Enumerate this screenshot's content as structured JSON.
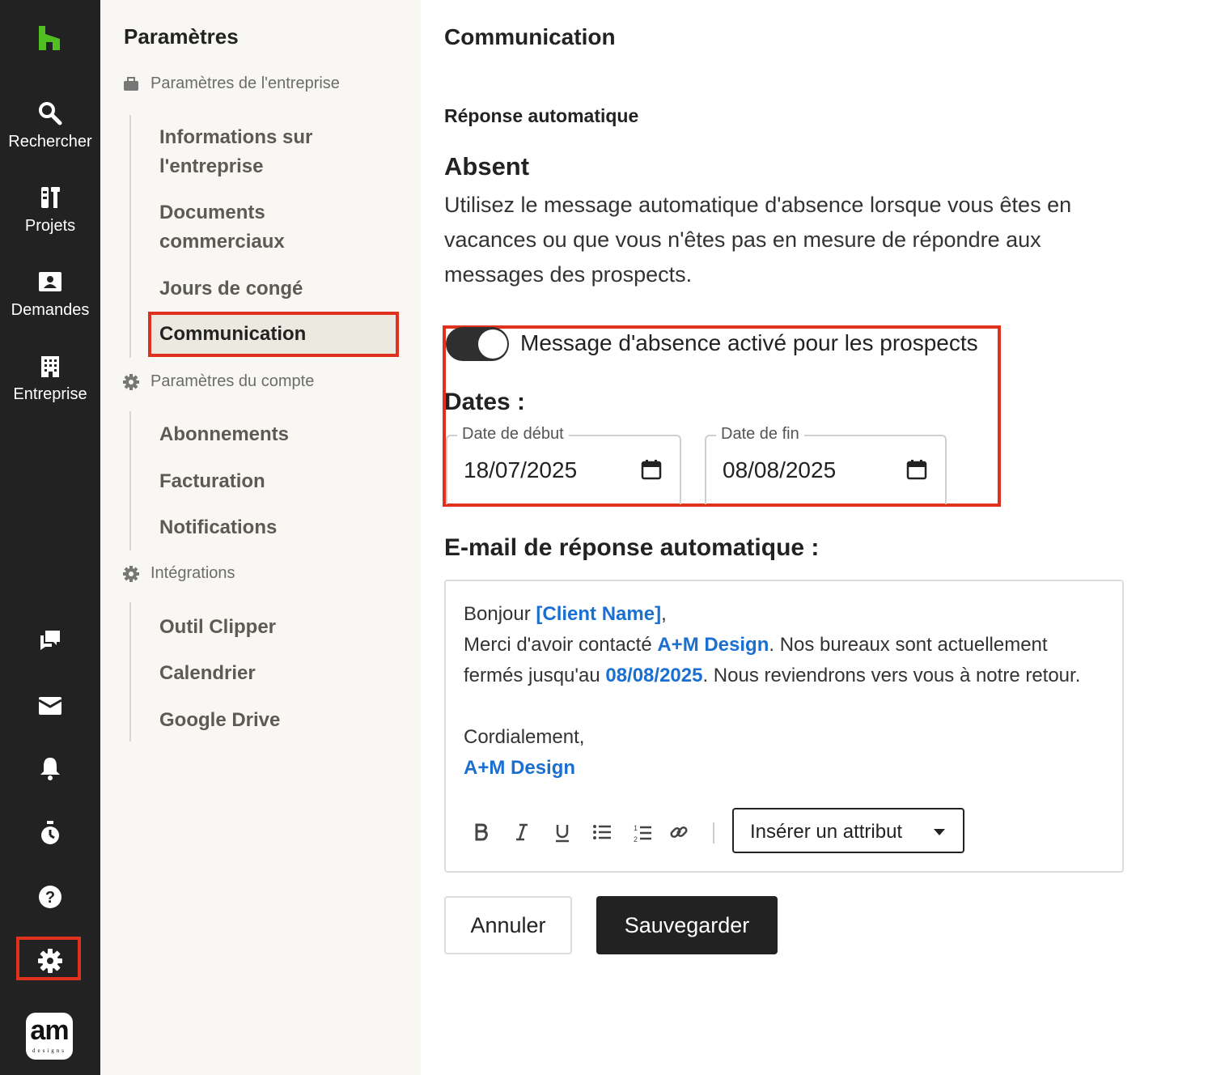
{
  "rail": {
    "search_label": "Rechercher",
    "projects_label": "Projets",
    "requests_label": "Demandes",
    "company_label": "Entreprise",
    "avatar_text": "am",
    "avatar_sub": "designs",
    "logo_color": "#4fbf22"
  },
  "sidebar": {
    "title": "Paramètres",
    "company_group": "Paramètres de l'entreprise",
    "company_items": [
      "Informations sur l'entreprise",
      "Documents commerciaux",
      "Jours de congé",
      "Communication"
    ],
    "account_group": "Paramètres du compte",
    "account_items": [
      "Abonnements",
      "Facturation",
      "Notifications"
    ],
    "integrations_group": "Intégrations",
    "integration_items": [
      "Outil Clipper",
      "Calendrier",
      "Google Drive"
    ]
  },
  "main": {
    "title": "Communication",
    "section": "Réponse automatique",
    "absent_title": "Absent",
    "absent_desc": "Utilisez le message automatique d'absence lorsque vous êtes en vacances ou que vous n'êtes pas en mesure de répondre aux messages des prospects.",
    "toggle_label": "Message d'absence activé pour les prospects",
    "toggle_on": true,
    "dates_title": "Dates :",
    "start_label": "Date de début",
    "start_value": "18/07/2025",
    "end_label": "Date de fin",
    "end_value": "08/08/2025",
    "email_title": "E-mail de réponse automatique :",
    "email": {
      "greeting": "Bonjour ",
      "client_attr": "[Client Name]",
      "comma": ",",
      "line2_a": "Merci d'avoir contacté ",
      "company_attr": "A+M Design",
      "line2_b": ". Nos bureaux sont actuellement fermés jusqu'au ",
      "date_attr": "08/08/2025",
      "line2_c": ". Nous reviendrons vers vous à notre retour.",
      "closing": "Cordialement,",
      "signature_attr": "A+M Design"
    },
    "insert_attribute": "Insérer un attribut",
    "cancel": "Annuler",
    "save": "Sauvegarder"
  },
  "colors": {
    "accent_red": "#e0301e",
    "attribute_blue": "#1a6fd1",
    "rail_bg": "#222222"
  }
}
